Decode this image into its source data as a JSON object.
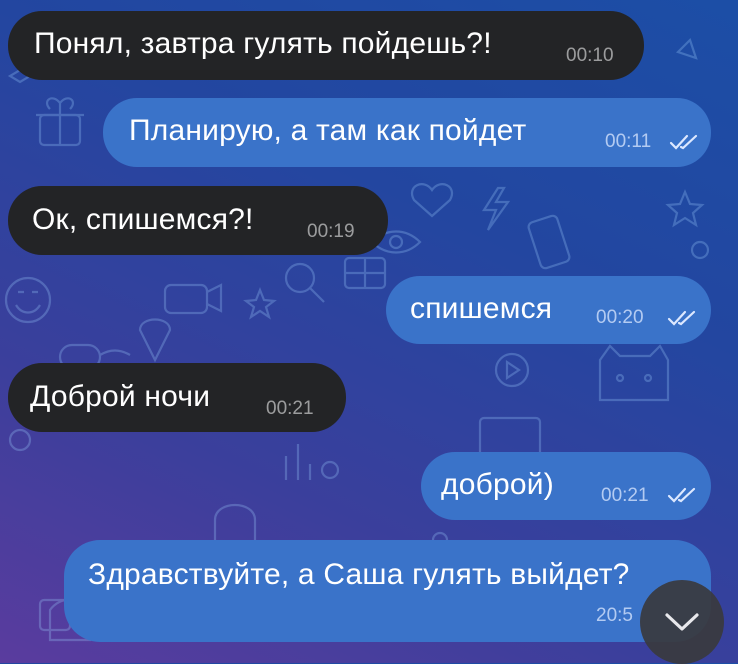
{
  "colors": {
    "incoming_bubble": "#232426",
    "outgoing_bubble": "#3a73c9",
    "read_checks": "#dce8ff"
  },
  "messages": [
    {
      "direction": "incoming",
      "text": "Понял, завтра гулять пойдешь?!",
      "time": "00:10"
    },
    {
      "direction": "outgoing",
      "text": "Планирую, а там как пойдет",
      "time": "00:11",
      "status": "read"
    },
    {
      "direction": "incoming",
      "text": "Ок, спишемся?!",
      "time": "00:19"
    },
    {
      "direction": "outgoing",
      "text": "спишемся",
      "time": "00:20",
      "status": "read"
    },
    {
      "direction": "incoming",
      "text": "Доброй ночи",
      "time": "00:21"
    },
    {
      "direction": "outgoing",
      "text": "доброй)",
      "time": "00:21",
      "status": "read"
    },
    {
      "direction": "outgoing",
      "text": "Здравствуйте, а Саша гулять выйдет?",
      "time": "20:5"
    }
  ],
  "scroll_button": {
    "icon": "chevron-down-icon"
  }
}
